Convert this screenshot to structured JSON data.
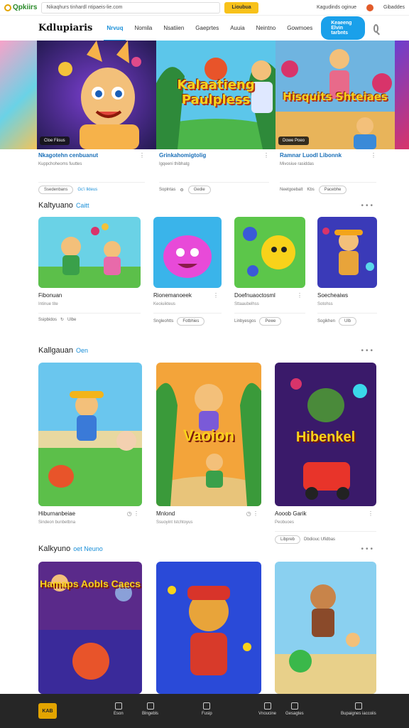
{
  "topbar": {
    "logo": "Qpkiirs",
    "url_text": "Nikaqhurs tinhardl ntipaeis-lie.com",
    "url_button": "Lioubua",
    "right_links": [
      "Kagudinds oginue",
      "Gibaddes"
    ]
  },
  "nav": {
    "brand": "Kdlupiaris",
    "items": [
      "Nrvuq",
      "Nomila",
      "Nsatiien",
      "Gaeprtes",
      "Auuia",
      "Neintno"
    ],
    "right_link": "Gowmoes",
    "primary_button": "Keaeeng Elvin tarbnts"
  },
  "hero": {
    "tiles": [
      {
        "title": "",
        "badge": "Cloe Fiisus"
      },
      {
        "title": "Kalaatieng Paulpless",
        "badge": ""
      },
      {
        "title": "Hisquits Shteiaes",
        "badge": "Dowe Poeo"
      }
    ],
    "meta": [
      {
        "title": "Nkagotehn cenbuanut",
        "sub": "Kuppchoheoms fuuttes",
        "pill": "Ssedenbans",
        "link": "Gc'i Ikteus"
      },
      {
        "title": "Grinkahomigtolig",
        "sub": "Igqeeni thibhatg",
        "action": "Soplntas",
        "pill": "Gedie"
      },
      {
        "title": "Ramnar Luodl Libonnk",
        "sub": "Mivosiue rasiddas",
        "action": "Neetgoebalt",
        "count": "Kbs",
        "pill": "Pacebhe"
      }
    ]
  },
  "sections": [
    {
      "title": "Kaltyuano",
      "accent": "Caitt",
      "cards": [
        {
          "title": "Fibonuan",
          "sub": "Intinue tite",
          "act": "Ssipbidos",
          "pill": "Ulbe"
        },
        {
          "title": "Rionemanoeek",
          "sub": "Keoiuikteus",
          "act": "Sngleohtts",
          "pill": "Fotbhies"
        },
        {
          "title": "Doefnuaoctosml",
          "sub": "Sttaaubelhss",
          "act": "Linbyesgos",
          "pill": "Pewe"
        },
        {
          "title": "Soecheaiws",
          "sub": "Sotohss",
          "act": "Sogikhen",
          "pill": "Ulb"
        }
      ]
    },
    {
      "title": "Kallgauan",
      "accent": "Oen",
      "cards": [
        {
          "title": "Hiburnanbeiae",
          "sub": "Sindeon bunbetbna",
          "thumb": ""
        },
        {
          "title": "Mnlond",
          "sub": "Ssuoyint lstchtoyus",
          "thumb": "Vaoion"
        },
        {
          "title": "Aooob Garik",
          "sub": "Peobuoes",
          "thumb": "Hibenkel",
          "act": "Libpreb",
          "act2": "Dbdiouc Ufidbas"
        }
      ]
    },
    {
      "title": "Kalkyuno",
      "accent": "oet Neuno",
      "cards": [
        {
          "thumb": "Hamaps Aobls Caecs"
        },
        {
          "thumb": ""
        },
        {
          "thumb": ""
        }
      ]
    }
  ],
  "bottom": {
    "logo": "KAB",
    "items": [
      "Eson",
      "Blngebls",
      "Fusip",
      "Vnoucine",
      "Gesagtes",
      "Bupaignes iaccoiis"
    ]
  },
  "colors": {
    "accent": "#1a8fd8",
    "brand_yellow": "#f8c21a",
    "bottom_bar": "#262626"
  }
}
